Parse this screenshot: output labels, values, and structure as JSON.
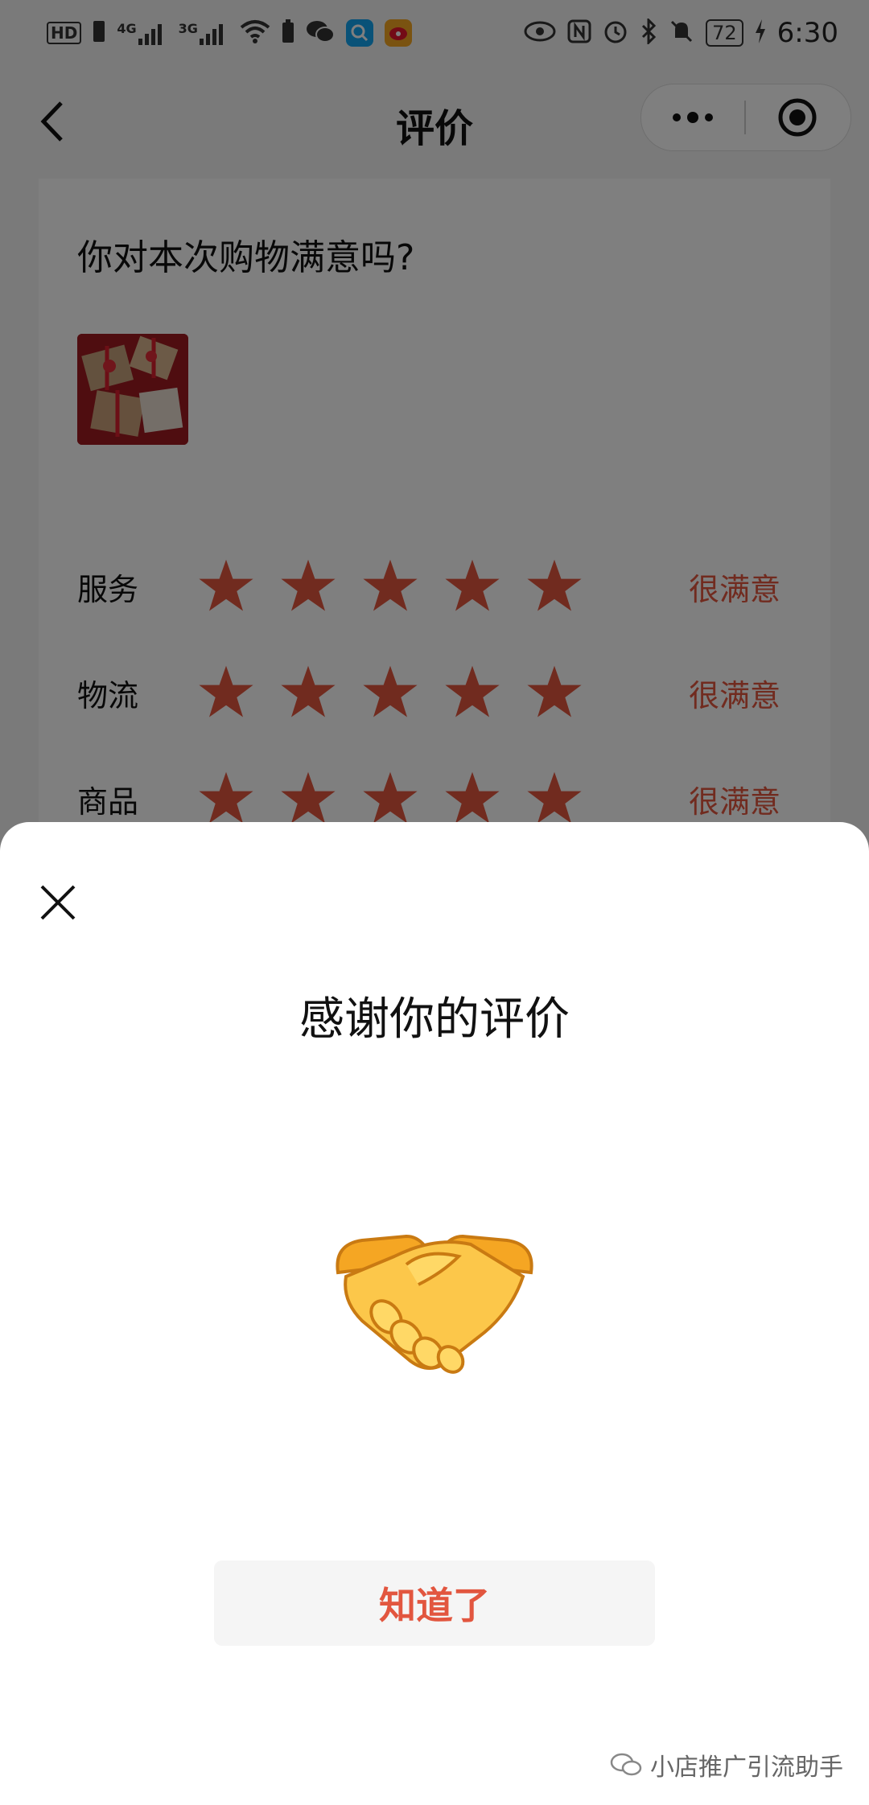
{
  "status_bar": {
    "network_labels": [
      "HD",
      "4G",
      "3G"
    ],
    "battery": "72",
    "time": "6:30",
    "icons": [
      "hd-icon",
      "sim-icon",
      "signal-4g-icon",
      "signal-3g-icon",
      "wifi-icon",
      "battery-saver-icon",
      "wechat-icon",
      "search-app-icon",
      "weibo-icon",
      "eye-icon",
      "nfc-icon",
      "alarm-icon",
      "bluetooth-icon",
      "mute-icon",
      "battery-icon",
      "charging-icon"
    ]
  },
  "nav": {
    "title": "评价",
    "back_icon": "chevron-left-icon",
    "more_icon": "more-dots-icon",
    "target_icon": "target-icon"
  },
  "card": {
    "question": "你对本次购物满意吗?",
    "ratings": [
      {
        "label": "服务",
        "stars": 5,
        "max": 5,
        "text": "很满意"
      },
      {
        "label": "物流",
        "stars": 5,
        "max": 5,
        "text": "很满意"
      },
      {
        "label": "商品",
        "stars": 5,
        "max": 5,
        "text": "很满意"
      }
    ]
  },
  "sheet": {
    "title": "感谢你的评价",
    "close_icon": "close-icon",
    "emoji_icon": "handshake-icon",
    "confirm_label": "知道了"
  },
  "watermark": {
    "text": "小店推广引流助手",
    "icon": "wechat-official-icon"
  },
  "colors": {
    "accent": "#e2563f",
    "overlay": "rgba(0,0,0,0.5)",
    "sheet_bg": "#ffffff",
    "page_bg": "#f4f4f4"
  }
}
